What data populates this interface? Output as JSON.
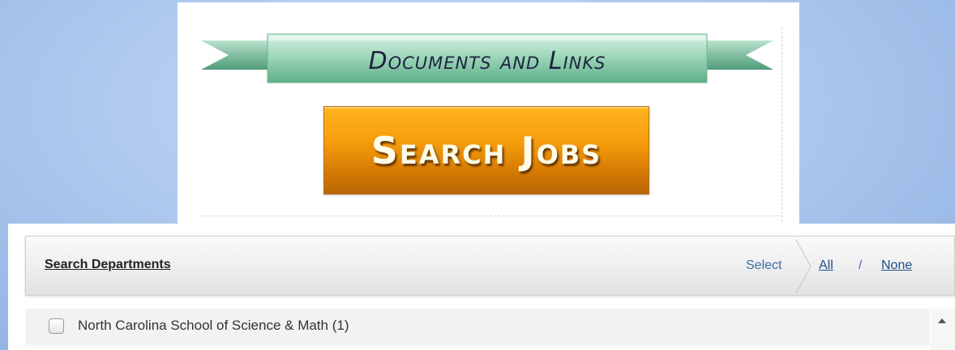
{
  "banner": {
    "title": "Documents and Links"
  },
  "search_jobs": {
    "label": "Search Jobs"
  },
  "departments": {
    "title": "Search Departments",
    "select_label": "Select",
    "all_label": "All",
    "separator": "/",
    "none_label": "None",
    "items": [
      {
        "label": "North Carolina School of Science & Math (1)",
        "checked": false
      }
    ]
  },
  "colors": {
    "ribbon": "#7cc6a4",
    "button": "#f39a0b",
    "link": "#1f4f85"
  },
  "icons": [
    "ribbon-banner",
    "chevron-separator-icon",
    "scroll-up-icon"
  ]
}
